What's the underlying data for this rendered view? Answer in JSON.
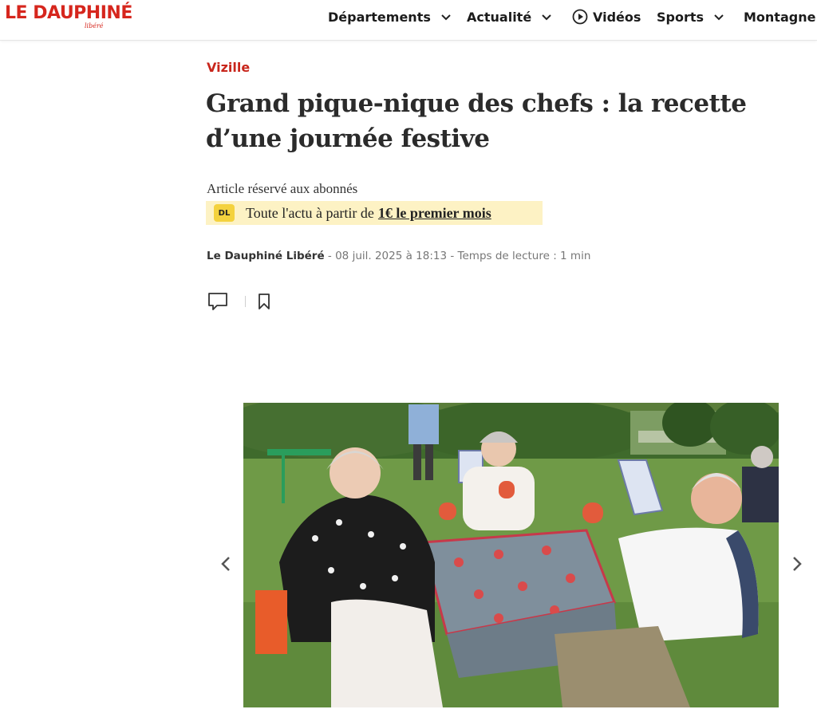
{
  "brand": {
    "logo_main": "LE DAUPHINÉ",
    "logo_sub": "libéré",
    "color": "#d6261d"
  },
  "nav": {
    "items": [
      {
        "label": "Départements",
        "icon": "chevron-down-icon"
      },
      {
        "label": "Actualité",
        "icon": "chevron-down-icon"
      },
      {
        "label": "Vidéos",
        "icon": "play-circle-icon"
      },
      {
        "label": "Sports",
        "icon": "chevron-down-icon"
      },
      {
        "label": "Montagne"
      }
    ]
  },
  "article": {
    "kicker": "Vizille",
    "title": "Grand pique-nique des chefs : la recette d’une journée festive",
    "subscriber_notice": "Article réservé aux abonnés",
    "promo": {
      "badge": "DL",
      "text": "Toute l'actu à partir de",
      "offer": "1€ le premier mois",
      "background": "#fdf2c4"
    },
    "byline": {
      "author": "Le Dauphiné Libéré",
      "separator": "-",
      "date": "08 juil. 2025 à 18:13",
      "reading_time": "Temps de lecture : 1 min"
    },
    "actions": {
      "comment_icon": "comment-icon",
      "bookmark_icon": "bookmark-icon"
    }
  },
  "slideshow": {
    "prev_icon": "chevron-left-icon",
    "next_icon": "chevron-right-icon",
    "image": "photo-picnic"
  }
}
